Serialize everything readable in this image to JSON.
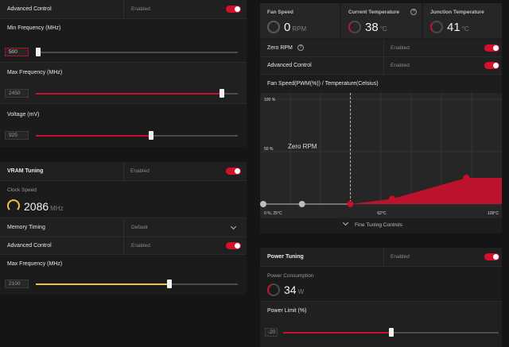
{
  "gpu": {
    "advanced_control": {
      "label": "Advanced Control",
      "state": "Enabled"
    },
    "min_freq": {
      "label": "Min Frequency (MHz)",
      "value": "500",
      "fraction": 0.01
    },
    "max_freq": {
      "label": "Max Frequency (MHz)",
      "value": "2450",
      "fraction": 0.92
    },
    "voltage": {
      "label": "Voltage (mV)",
      "value": "925",
      "fraction": 0.57
    }
  },
  "vram": {
    "title": "VRAM Tuning",
    "state": "Enabled",
    "clock_label": "Clock Speed",
    "clock_value": "2086",
    "clock_unit": "MHz",
    "memory_timing": {
      "label": "Memory Timing",
      "value": "Default"
    },
    "advanced_control": {
      "label": "Advanced Control",
      "state": "Enabled"
    },
    "max_freq": {
      "label": "Max Frequency (MHz)",
      "value": "2100",
      "fraction": 0.66
    }
  },
  "fan": {
    "speed_label": "Fan Speed",
    "speed_value": "0",
    "speed_unit": "RPM",
    "current_temp_label": "Current Temperature",
    "current_temp_value": "38",
    "current_temp_unit": "°C",
    "junction_temp_label": "Junction Temperature",
    "junction_temp_value": "41",
    "junction_temp_unit": "°C",
    "zero_rpm": {
      "label": "Zero RPM",
      "state": "Enabled"
    },
    "advanced_control": {
      "label": "Advanced Control",
      "state": "Enabled"
    },
    "fine_tuning_label": "Fine Tuning Controls"
  },
  "chart_data": {
    "type": "line",
    "title": "Fan Speed(PWM(%)) / Temperature(Celsius)",
    "annotation": "Zero RPM",
    "y_ticks": [
      "100 %",
      "50 %"
    ],
    "x_ticks": [
      "0 %, 25°C",
      "62°C",
      "100°C"
    ],
    "xlim": [
      25,
      100
    ],
    "ylim": [
      0,
      100
    ],
    "zero_rpm_stop_temp": 53,
    "points": [
      {
        "x": 25,
        "y": 0,
        "active": false
      },
      {
        "x": 38,
        "y": 0,
        "active": false
      },
      {
        "x": 53,
        "y": 0,
        "active": true
      },
      {
        "x": 66,
        "y": 5,
        "active": true
      },
      {
        "x": 89,
        "y": 25,
        "active": true
      },
      {
        "x": 100,
        "y": 25,
        "active": true
      }
    ],
    "colors": {
      "curve": "#c8102e",
      "inactive": "#bdbdbd"
    }
  },
  "power": {
    "title": "Power Tuning",
    "state": "Enabled",
    "consumption_label": "Power Consumption",
    "consumption_value": "34",
    "consumption_unit": "W",
    "limit_label": "Power Limit (%)",
    "limit_value": "-20",
    "limit_fraction": 0.5
  },
  "icons": {
    "gauge": "gauge-icon",
    "help": "help-icon",
    "chevron": "chevron-down-icon"
  },
  "colors": {
    "accent": "#c8102e",
    "vram_accent": "#f5c040"
  }
}
